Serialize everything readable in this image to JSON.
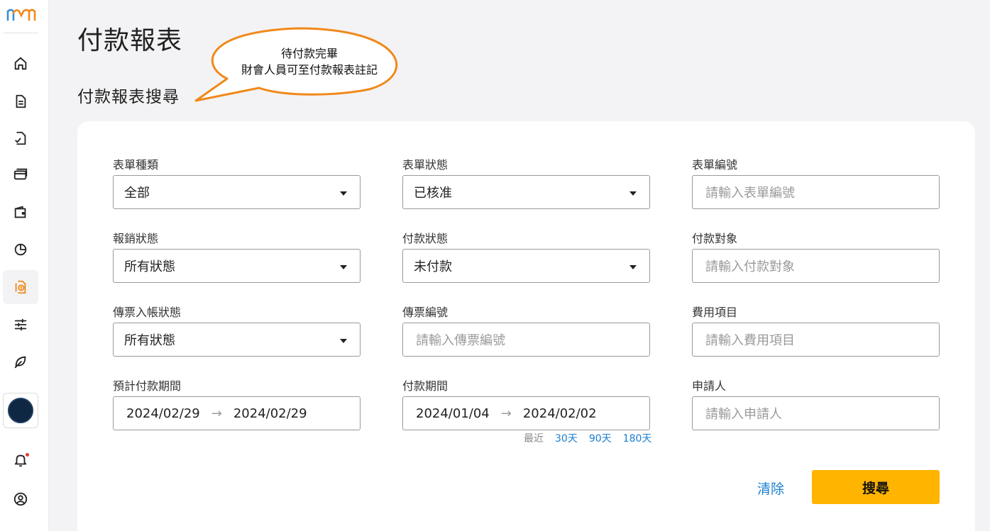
{
  "page": {
    "title": "付款報表",
    "section_title": "付款報表搜尋"
  },
  "callout": {
    "line1": "待付款完畢",
    "line2": "財會人員可至付款報表註記"
  },
  "sidebar": {
    "items": [
      {
        "icon": "home-icon"
      },
      {
        "icon": "document-icon"
      },
      {
        "icon": "document-check-icon"
      },
      {
        "icon": "credit-card-icon"
      },
      {
        "icon": "wallet-icon"
      },
      {
        "icon": "pie-chart-icon"
      },
      {
        "icon": "payment-report-icon",
        "active": true
      },
      {
        "icon": "sliders-icon"
      },
      {
        "icon": "leaf-icon"
      }
    ],
    "accent": "#f0891a"
  },
  "form": {
    "form_type": {
      "label": "表單種類",
      "value": "全部"
    },
    "form_status": {
      "label": "表單狀態",
      "value": "已核准"
    },
    "form_number": {
      "label": "表單編號",
      "placeholder": "請輸入表單編號"
    },
    "reimburse_status": {
      "label": "報銷狀態",
      "value": "所有狀態"
    },
    "payment_status": {
      "label": "付款狀態",
      "value": "未付款"
    },
    "payee": {
      "label": "付款對象",
      "placeholder": "請輸入付款對象"
    },
    "voucher_status": {
      "label": "傳票入帳狀態",
      "value": "所有狀態"
    },
    "voucher_number": {
      "label": "傳票編號",
      "placeholder": "請輸入傳票編號"
    },
    "expense_item": {
      "label": "費用項目",
      "placeholder": "請輸入費用項目"
    },
    "expected_period": {
      "label": "預計付款期間",
      "start": "2024/02/29",
      "end": "2024/02/29"
    },
    "payment_period": {
      "label": "付款期間",
      "start": "2024/01/04",
      "end": "2024/02/02"
    },
    "applicant": {
      "label": "申請人",
      "placeholder": "請輸入申請人"
    },
    "quick_range": {
      "prefix": "最近",
      "opt1": "30天",
      "opt2": "90天",
      "opt3": "180天"
    }
  },
  "actions": {
    "clear": "清除",
    "search": "搜尋"
  },
  "colors": {
    "primary_button": "#ffb400",
    "link": "#1a7fd0",
    "callout_border": "#f0891a"
  }
}
